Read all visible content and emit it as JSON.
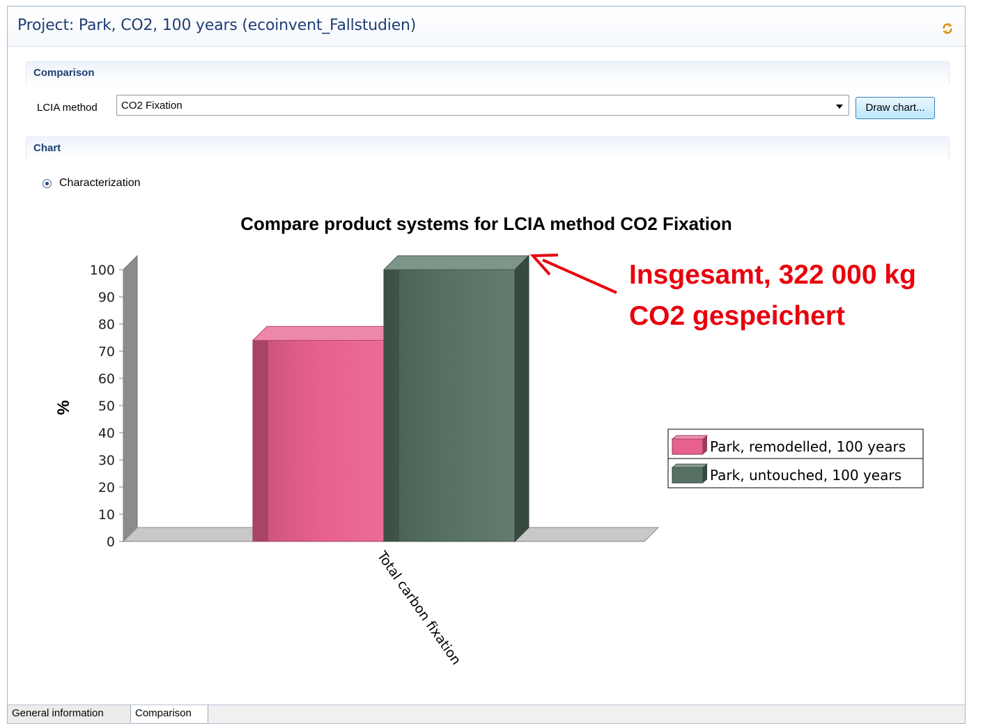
{
  "header": {
    "title": "Project: Park, CO2, 100 years (ecoinvent_Fallstudien)"
  },
  "comparison": {
    "section_title": "Comparison",
    "lcia_label": "LCIA method",
    "lcia_value": "CO2 Fixation",
    "draw_button": "Draw chart..."
  },
  "chart_section": {
    "section_title": "Chart",
    "radio_label": "Characterization",
    "radio_checked": true
  },
  "chart_data": {
    "type": "bar",
    "title": "Compare product systems for LCIA method CO2 Fixation",
    "ylabel": "%",
    "xlabel": "",
    "categories": [
      "Total carbon fixation"
    ],
    "ylim": [
      0,
      100
    ],
    "yticks": [
      0,
      10,
      20,
      30,
      40,
      50,
      60,
      70,
      80,
      90,
      100
    ],
    "series": [
      {
        "name": "Park, remodelled, 100 years",
        "values": [
          74
        ],
        "color": "#e8608e"
      },
      {
        "name": "Park, untouched, 100 years",
        "values": [
          100
        ],
        "color": "#567163"
      }
    ],
    "legend_position": "right",
    "grid": false
  },
  "annotation": {
    "line1": "Insgesamt, 322 000 kg",
    "line2": "CO2 gespeichert",
    "color": "#e8000d"
  },
  "tabs": [
    {
      "label": "General information",
      "active": false
    },
    {
      "label": "Comparison",
      "active": true
    }
  ]
}
